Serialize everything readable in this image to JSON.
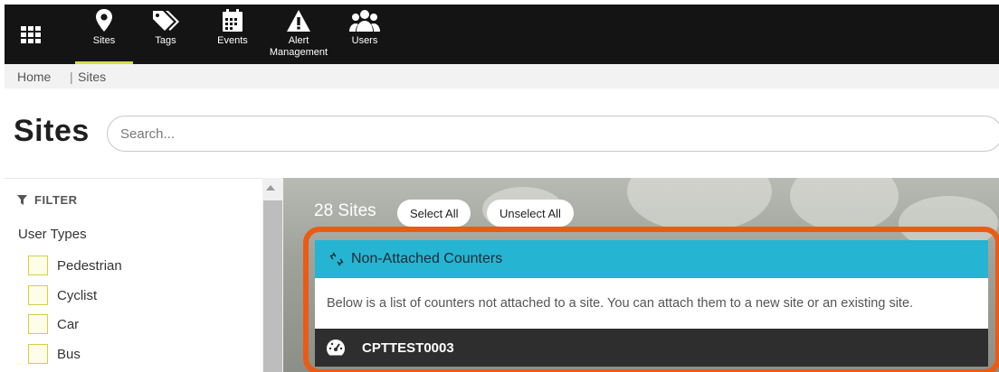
{
  "nav": {
    "apps_icon": "apps-grid-icon",
    "items": [
      {
        "label": "Sites",
        "icon": "map-pin-icon"
      },
      {
        "label": "Tags",
        "icon": "tags-icon"
      },
      {
        "label": "Events",
        "icon": "calendar-icon"
      },
      {
        "label": "Alert",
        "label2": "Management",
        "icon": "warning-icon"
      },
      {
        "label": "Users",
        "icon": "users-icon"
      }
    ],
    "active": "Sites",
    "active_color": "#d8de3a"
  },
  "breadcrumb": {
    "home": "Home",
    "separator": "|",
    "current": "Sites"
  },
  "page": {
    "title": "Sites",
    "search_placeholder": "Search..."
  },
  "filter": {
    "heading": "FILTER",
    "group_label": "User Types",
    "options": [
      "Pedestrian",
      "Cyclist",
      "Car",
      "Bus"
    ]
  },
  "sites": {
    "count_label": "28 Sites",
    "select_all": "Select All",
    "unselect_all": "Unselect All"
  },
  "non_attached": {
    "title": "Non-Attached Counters",
    "description": "Below is a list of counters not attached to a site. You can attach them to a new site or an existing site.",
    "counters": [
      "CPTTEST0003"
    ]
  },
  "colors": {
    "header_bg": "#141414",
    "card_header": "#26b4d3",
    "highlight": "#ea5b14",
    "counter_row": "#2e2e2e"
  }
}
